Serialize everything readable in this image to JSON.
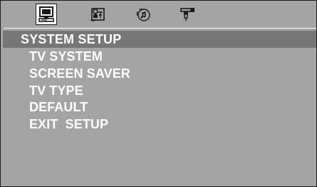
{
  "tabs": [
    {
      "icon": "monitor-icon",
      "active": true
    },
    {
      "icon": "language-icon",
      "active": false
    },
    {
      "icon": "disc-audio-icon",
      "active": false
    },
    {
      "icon": "video-connector-icon",
      "active": false
    }
  ],
  "section": {
    "title": "SYSTEM SETUP"
  },
  "menu": {
    "items": [
      {
        "label": "TV SYSTEM"
      },
      {
        "label": "SCREEN SAVER"
      },
      {
        "label": "TV TYPE"
      },
      {
        "label": "DEFAULT"
      },
      {
        "label": "EXIT  SETUP"
      }
    ]
  },
  "colors": {
    "background": "#a4a4a4",
    "title_bar": "#767676",
    "text": "#ffffff",
    "active_tab": "#ffffff"
  }
}
